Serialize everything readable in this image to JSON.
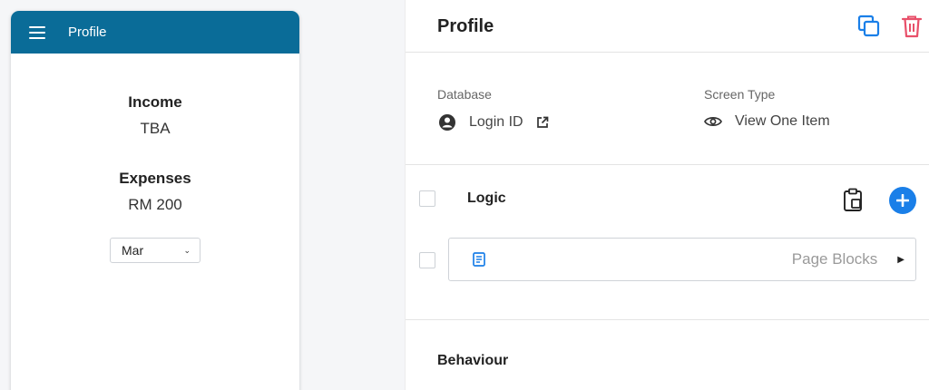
{
  "preview": {
    "header_title": "Profile",
    "fields": [
      {
        "label": "Income",
        "value": "TBA"
      },
      {
        "label": "Expenses",
        "value": "RM 200"
      }
    ],
    "month_select": {
      "value": "Mar"
    }
  },
  "panel": {
    "title": "Profile",
    "database": {
      "label": "Database",
      "value": "Login ID"
    },
    "screen_type": {
      "label": "Screen Type",
      "value": "View One Item"
    },
    "logic": {
      "title": "Logic",
      "page_blocks_label": "Page Blocks"
    },
    "behaviour_title": "Behaviour"
  },
  "colors": {
    "header_bg": "#0a6c98",
    "accent_blue": "#1a7fe8",
    "delete_red": "#e8506a"
  },
  "icons": {
    "menu": "hamburger-icon",
    "copy": "copy-icon",
    "delete": "trash-icon",
    "account": "account-circle-icon",
    "external": "external-link-icon",
    "view": "eye-icon",
    "paste": "clipboard-icon",
    "add": "plus-circle-icon",
    "page": "document-icon",
    "caret": "caret-right-icon"
  }
}
